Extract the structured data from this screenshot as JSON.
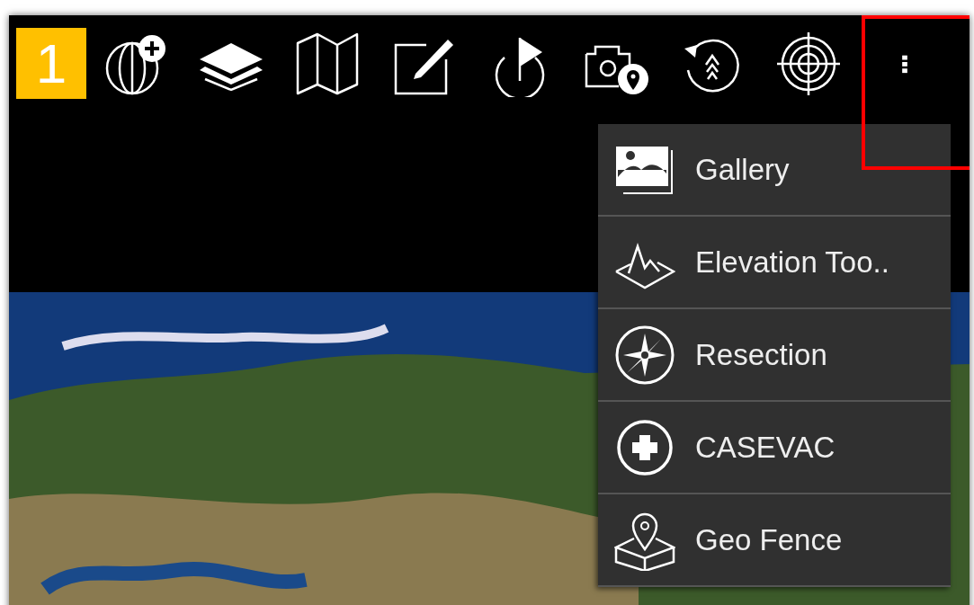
{
  "toolbar": {
    "badge": "1",
    "buttons": [
      {
        "kind": "globe-add"
      },
      {
        "kind": "layers"
      },
      {
        "kind": "map"
      },
      {
        "kind": "edit"
      },
      {
        "kind": "flag-timer"
      },
      {
        "kind": "camera-pin"
      },
      {
        "kind": "rotate-chevrons"
      },
      {
        "kind": "target"
      },
      {
        "kind": "overflow",
        "highlighted": true
      }
    ]
  },
  "menu": {
    "items": [
      {
        "label": "Gallery",
        "kind": "gallery"
      },
      {
        "label": "Elevation Too..",
        "kind": "elevation"
      },
      {
        "label": "Resection",
        "kind": "compass"
      },
      {
        "label": "CASEVAC",
        "kind": "medical"
      },
      {
        "label": "Geo Fence",
        "kind": "geofence"
      }
    ]
  }
}
